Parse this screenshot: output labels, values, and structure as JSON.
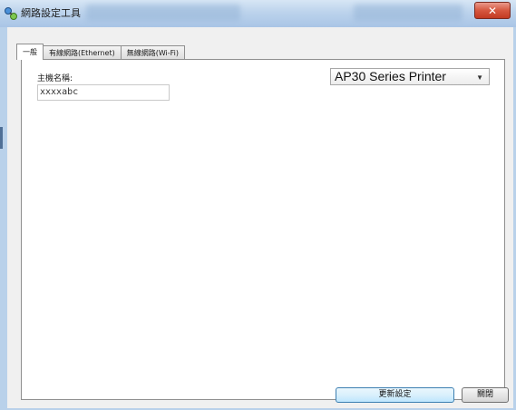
{
  "window": {
    "title": "網路設定工具",
    "close_label": "✕"
  },
  "tabs": [
    {
      "label": "一般",
      "active": true
    },
    {
      "label": "有線網路(Ethernet)",
      "active": false
    },
    {
      "label": "無線網路(Wi-Fi)",
      "active": false
    }
  ],
  "general": {
    "host_name_label": "主機名稱:",
    "host_name_value": "xxxxabc",
    "printer_selected": "AP30 Series Printer",
    "dropdown_arrow": "▼"
  },
  "buttons": {
    "update_settings": "更新設定",
    "close": "關閉"
  },
  "colors": {
    "title_bar": "#bcd3ec",
    "close_button": "#d6573f",
    "client_background": "#f0f0f0",
    "default_button_border": "#3c7fb1"
  }
}
